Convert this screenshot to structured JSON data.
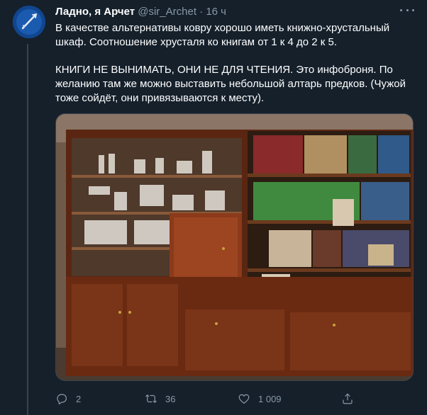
{
  "tweet": {
    "author_name": "Ладно, я Арчет",
    "handle": "@sir_Archet",
    "separator": "·",
    "time": "16 ч",
    "paragraph_1": "В качестве альтернативы ковру хорошо иметь книжно-хрустальный шкаф. Соотношение хрусталя ко книгам от 1 к 4 до 2 к 5.",
    "paragraph_2": "КНИГИ НЕ ВЫНИМАТЬ, ОНИ НЕ ДЛЯ ЧТЕНИЯ. Это инфоброня. По желанию там же можно выставить небольшой алтарь предков. (Чужой тоже сойдёт, они привязываются к месту)."
  },
  "actions": {
    "reply_count": "2",
    "retweet_count": "36",
    "like_count": "1 009"
  },
  "icons": {
    "more": "more-horizontal-icon",
    "reply": "reply-icon",
    "retweet": "retweet-icon",
    "like": "heart-icon",
    "share": "share-icon"
  },
  "colors": {
    "background": "#15202b",
    "text": "#ffffff",
    "muted": "#8899a6",
    "border": "#38444d"
  }
}
